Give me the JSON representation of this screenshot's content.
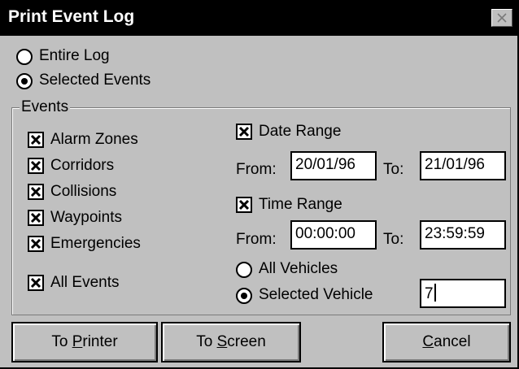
{
  "dialog": {
    "title": "Print Event Log",
    "close_icon": "close-icon"
  },
  "scope": {
    "entire_log": {
      "label": "Entire Log",
      "selected": false
    },
    "selected_events": {
      "label": "Selected Events",
      "selected": true
    }
  },
  "events_group": {
    "label": "Events",
    "items": [
      {
        "label": "Alarm Zones",
        "checked": true
      },
      {
        "label": "Corridors",
        "checked": true
      },
      {
        "label": "Collisions",
        "checked": true
      },
      {
        "label": "Waypoints",
        "checked": true
      },
      {
        "label": "Emergencies",
        "checked": true
      }
    ],
    "all_events": {
      "label": "All Events",
      "checked": true
    }
  },
  "date_range": {
    "label": "Date Range",
    "checked": true,
    "from_label": "From:",
    "from_value": "20/01/96",
    "to_label": "To:",
    "to_value": "21/01/96"
  },
  "time_range": {
    "label": "Time Range",
    "checked": true,
    "from_label": "From:",
    "from_value": "00:00:00",
    "to_label": "To:",
    "to_value": "23:59:59"
  },
  "vehicles": {
    "all": {
      "label": "All Vehicles",
      "selected": false
    },
    "selected": {
      "label": "Selected Vehicle",
      "selected": true
    },
    "value": "7"
  },
  "buttons": {
    "to_printer": {
      "pre": "To ",
      "mnemonic": "P",
      "post": "rinter"
    },
    "to_screen": {
      "pre": "To ",
      "mnemonic": "S",
      "post": "creen"
    },
    "cancel": {
      "pre": "",
      "mnemonic": "C",
      "post": "ancel"
    }
  }
}
